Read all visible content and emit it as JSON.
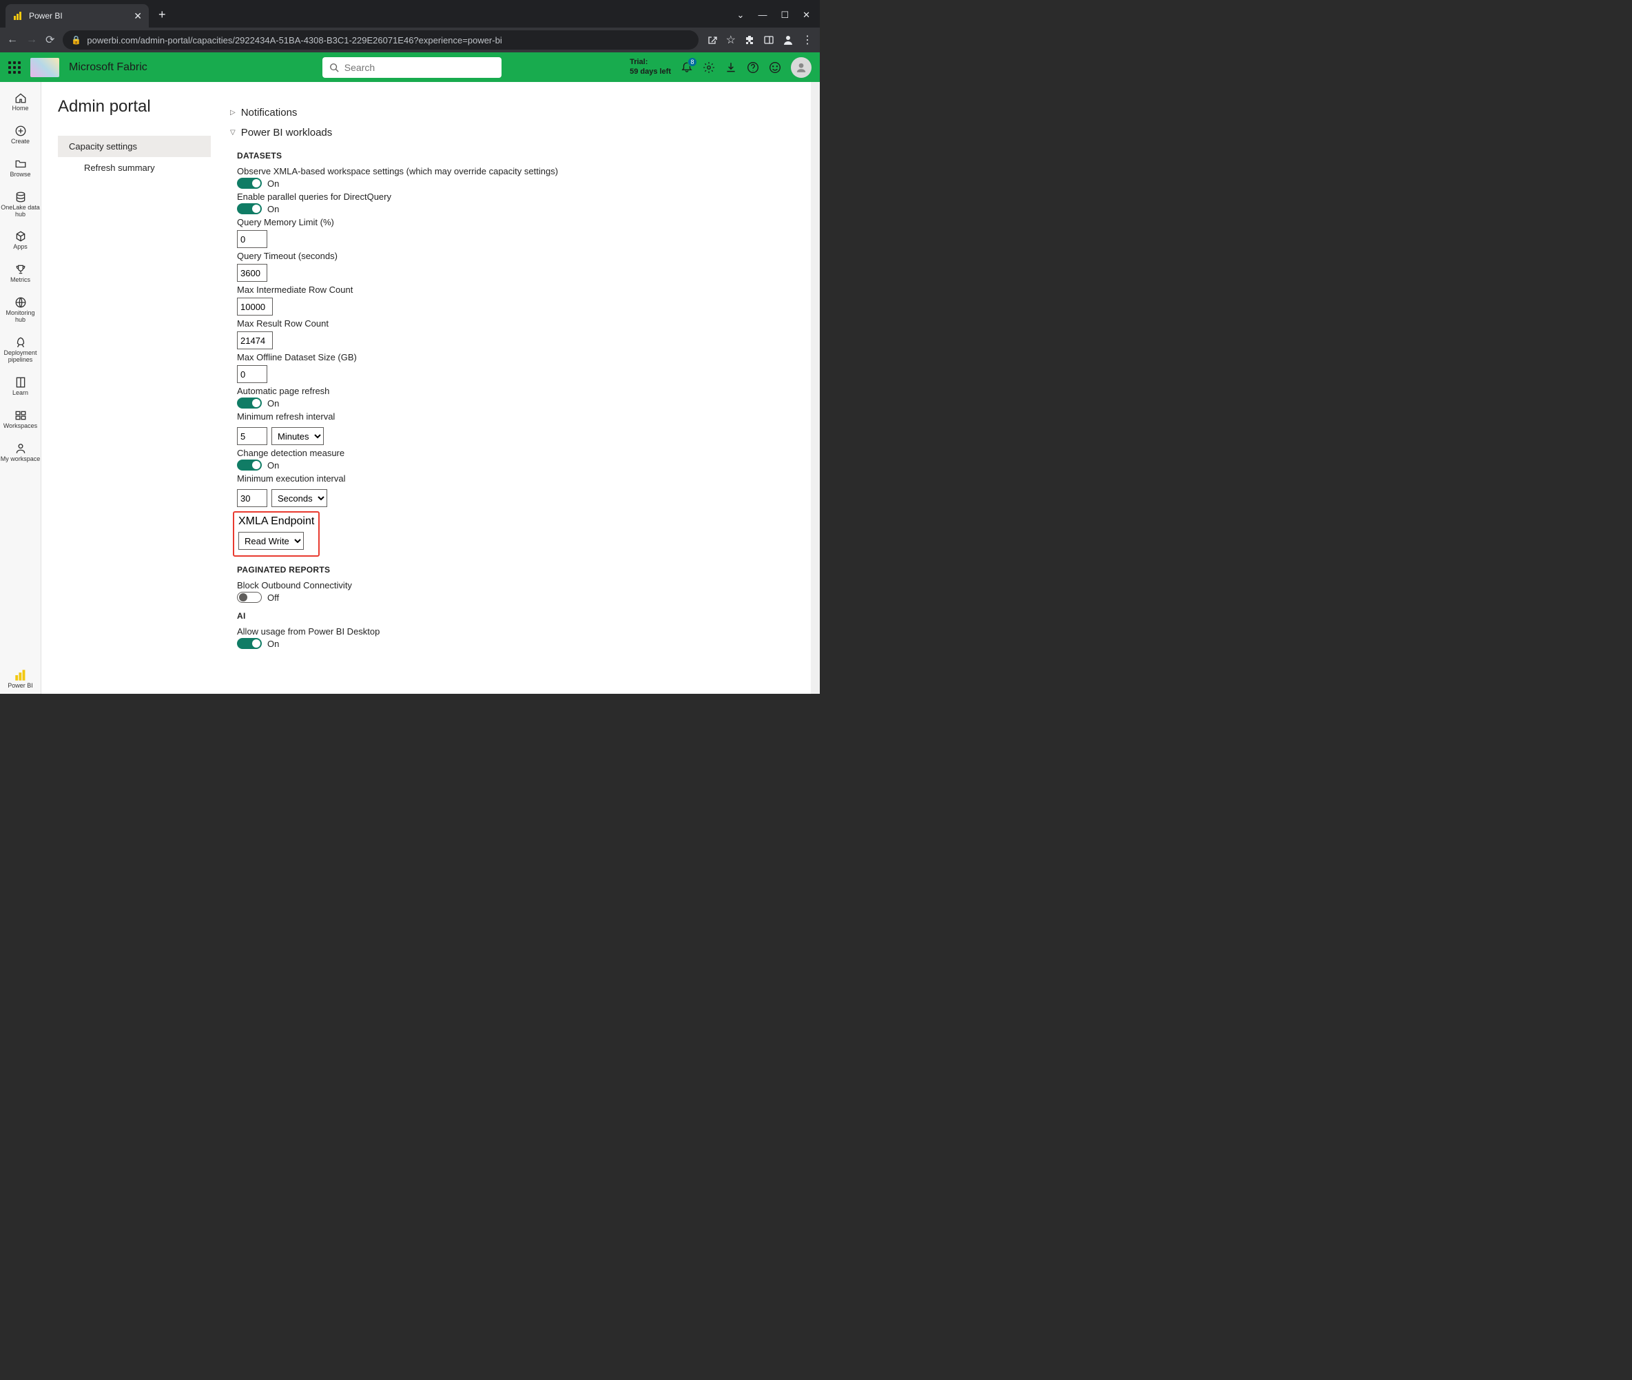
{
  "browser": {
    "tab_title": "Power BI",
    "url": "powerbi.com/admin-portal/capacities/2922434A-51BA-4308-B3C1-229E26071E46?experience=power-bi"
  },
  "fabric": {
    "brand": "Microsoft Fabric",
    "search_placeholder": "Search",
    "trial_label": "Trial:",
    "trial_days": "59 days left",
    "notif_count": "8"
  },
  "nav": {
    "home": "Home",
    "create": "Create",
    "browse": "Browse",
    "onelake": "OneLake data hub",
    "apps": "Apps",
    "metrics": "Metrics",
    "monitoring": "Monitoring hub",
    "deployment": "Deployment pipelines",
    "learn": "Learn",
    "workspaces": "Workspaces",
    "myworkspace": "My workspace",
    "powerbi": "Power BI"
  },
  "page": {
    "title": "Admin portal",
    "menu": {
      "capacity": "Capacity settings",
      "refresh": "Refresh summary"
    }
  },
  "acc": {
    "notifications": "Notifications",
    "workloads": "Power BI workloads"
  },
  "sections": {
    "datasets": "DATASETS",
    "paginated": "PAGINATED REPORTS",
    "ai": "AI"
  },
  "settings": {
    "observe_xmla": "Observe XMLA-based workspace settings (which may override capacity settings)",
    "parallel_dq": "Enable parallel queries for DirectQuery",
    "qmem": "Query Memory Limit (%)",
    "qmem_val": "0",
    "qtimeout": "Query Timeout (seconds)",
    "qtimeout_val": "3600",
    "maxirow": "Max Intermediate Row Count",
    "maxirow_val": "10000",
    "maxrrow": "Max Result Row Count",
    "maxrrow_val": "21474",
    "maxoffline": "Max Offline Dataset Size (GB)",
    "maxoffline_val": "0",
    "apr": "Automatic page refresh",
    "minref": "Minimum refresh interval",
    "minref_val": "5",
    "minref_unit": "Minutes",
    "chdet": "Change detection measure",
    "minexec": "Minimum execution interval",
    "minexec_val": "30",
    "minexec_unit": "Seconds",
    "xmla": "XMLA Endpoint",
    "xmla_val": "Read Write",
    "blockout": "Block Outbound Connectivity",
    "allowdesktop": "Allow usage from Power BI Desktop",
    "on": "On",
    "off": "Off"
  }
}
